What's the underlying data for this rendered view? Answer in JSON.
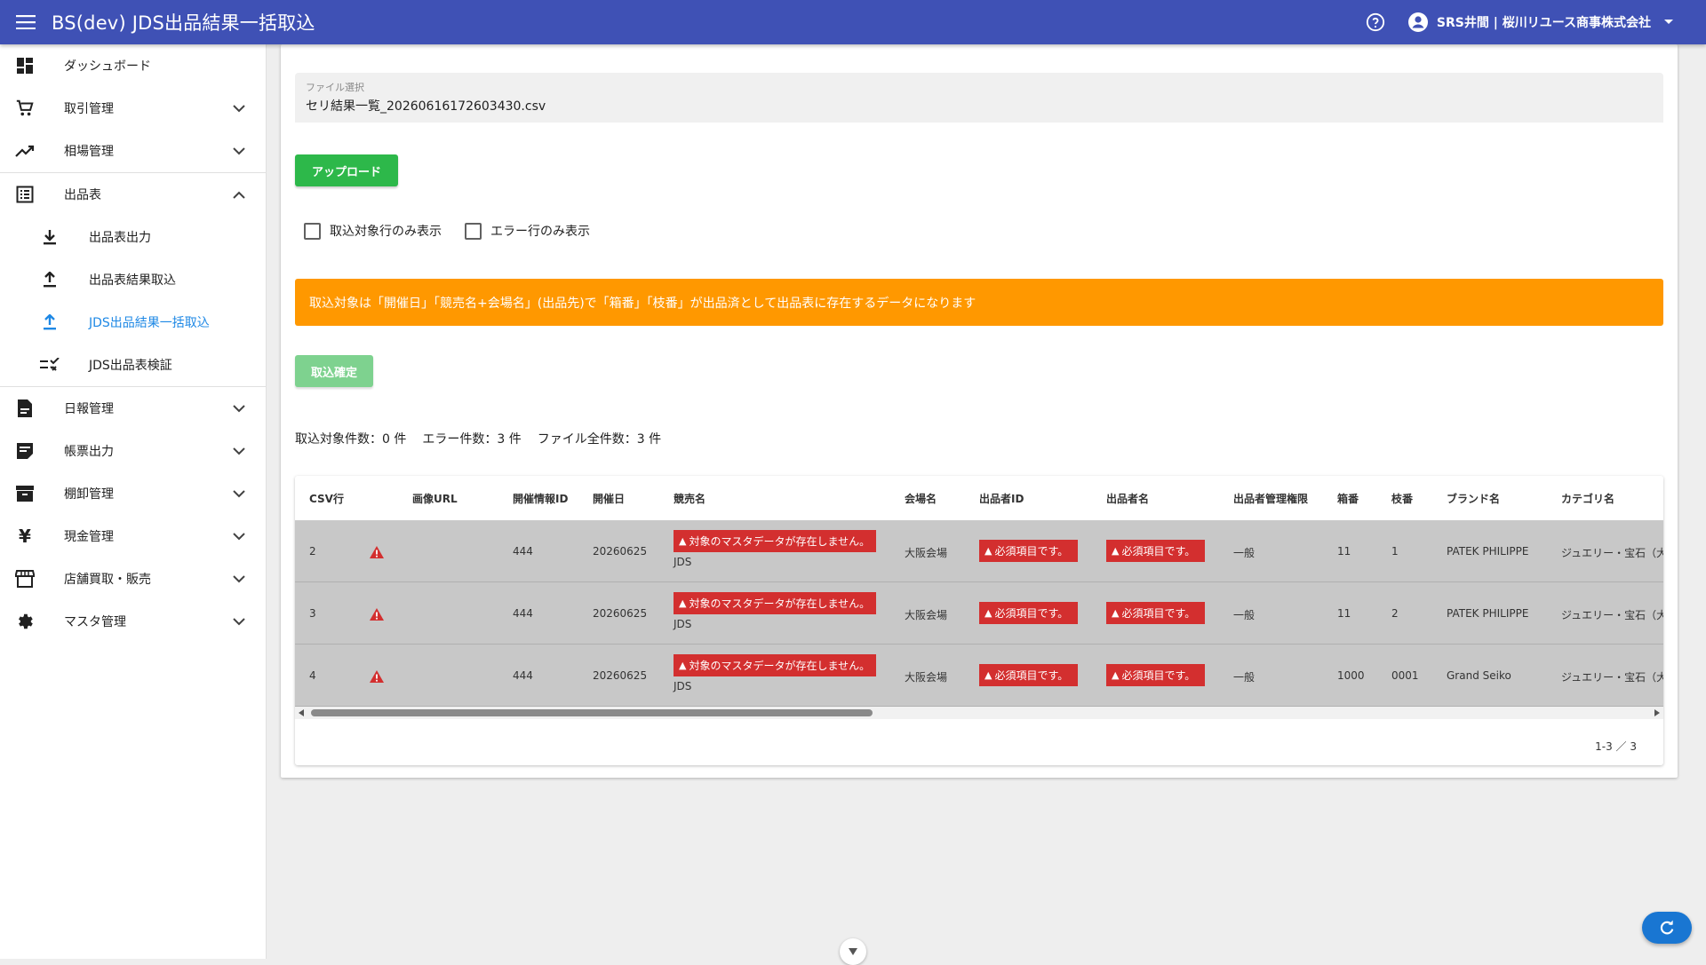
{
  "appbar": {
    "title": "BS(dev) JDS出品結果一括取込",
    "user": "SRS井間 | 桜川リユース商事株式会社"
  },
  "sidebar": {
    "items": [
      {
        "label": "ダッシュボード",
        "icon": "dashboard-icon"
      },
      {
        "label": "取引管理",
        "icon": "cart-icon"
      },
      {
        "label": "相場管理",
        "icon": "trending-up-icon"
      },
      {
        "label": "出品表",
        "icon": "list-icon"
      },
      {
        "label": "出品表出力",
        "icon": "download-icon"
      },
      {
        "label": "出品表結果取込",
        "icon": "upload-icon"
      },
      {
        "label": "JDS出品結果一括取込",
        "icon": "upload-icon"
      },
      {
        "label": "JDS出品表検証",
        "icon": "checklist-icon"
      },
      {
        "label": "日報管理",
        "icon": "document-icon"
      },
      {
        "label": "帳票出力",
        "icon": "report-icon"
      },
      {
        "label": "棚卸管理",
        "icon": "archive-icon"
      },
      {
        "label": "現金管理",
        "icon": "yen-icon"
      },
      {
        "label": "店舗買取・販売",
        "icon": "store-icon"
      },
      {
        "label": "マスタ管理",
        "icon": "gear-icon"
      }
    ]
  },
  "upload": {
    "file_label": "ファイル選択",
    "file_value": "セリ結果一覧_20260616172603430.csv",
    "upload_button": "アップロード",
    "show_target_only": "取込対象行のみ表示",
    "show_error_only": "エラー行のみ表示",
    "notice": "取込対象は「開催日」「競売名+会場名」(出品先)で「箱番」「枝番」が出品済として出品表に存在するデータになります",
    "confirm_button": "取込確定",
    "count_target": "取込対象件数：0 件",
    "count_error": "エラー件数：3 件",
    "count_total": "ファイル全件数：3 件"
  },
  "table": {
    "headers": [
      "CSV行",
      "画像URL",
      "開催情報ID",
      "開催日",
      "競売名",
      "会場名",
      "出品者ID",
      "出品者名",
      "出品者管理権限",
      "箱番",
      "枝番",
      "ブランド名",
      "カテゴリ名"
    ],
    "rows": [
      {
        "csv_row": "2",
        "event_id": "444",
        "date": "20260625",
        "auction_error": "対象のマスタデータが存在しません。",
        "auction": "JDS",
        "venue": "大阪会場",
        "seller_id_error": "必須項目です。",
        "seller_name_error": "必須項目です。",
        "permission": "一般",
        "box": "11",
        "branch": "1",
        "brand": "PATEK PHILIPPE",
        "category": "ジュエリー・宝石（大"
      },
      {
        "csv_row": "3",
        "event_id": "444",
        "date": "20260625",
        "auction_error": "対象のマスタデータが存在しません。",
        "auction": "JDS",
        "venue": "大阪会場",
        "seller_id_error": "必須項目です。",
        "seller_name_error": "必須項目です。",
        "permission": "一般",
        "box": "11",
        "branch": "2",
        "brand": "PATEK PHILIPPE",
        "category": "ジュエリー・宝石（大"
      },
      {
        "csv_row": "4",
        "event_id": "444",
        "date": "20260625",
        "auction_error": "対象のマスタデータが存在しません。",
        "auction": "JDS",
        "venue": "大阪会場",
        "seller_id_error": "必須項目です。",
        "seller_name_error": "必須項目です。",
        "permission": "一般",
        "box": "1000",
        "branch": "0001",
        "brand": "Grand Seiko",
        "category": "ジュエリー・宝石（大"
      }
    ],
    "pagination": "1-3 ／ 3"
  },
  "colors": {
    "appbar": "#3f51b5",
    "upload_button": "#2db84a",
    "notice": "#ff9800",
    "error_chip": "#d32f2f",
    "active_nav": "#1e88e5"
  }
}
